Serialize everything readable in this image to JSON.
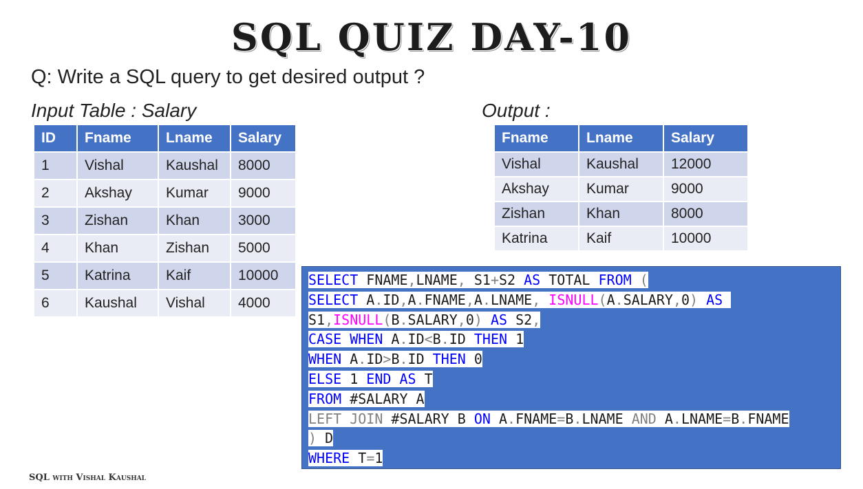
{
  "title": "SQL QUIZ DAY-10",
  "question": "Q: Write a SQL query to get desired output ?",
  "input": {
    "heading": "Input Table : Salary",
    "columns": [
      "ID",
      "Fname",
      "Lname",
      "Salary"
    ],
    "rows": [
      [
        "1",
        "Vishal",
        "Kaushal",
        "8000"
      ],
      [
        "2",
        "Akshay",
        "Kumar",
        "9000"
      ],
      [
        "3",
        "Zishan",
        "Khan",
        "3000"
      ],
      [
        "4",
        "Khan",
        "Zishan",
        "5000"
      ],
      [
        "5",
        "Katrina",
        "Kaif",
        "10000"
      ],
      [
        "6",
        "Kaushal",
        "Vishal",
        "4000"
      ]
    ]
  },
  "output": {
    "heading": "Output  :",
    "columns": [
      "Fname",
      "Lname",
      "Salary"
    ],
    "rows": [
      [
        "Vishal",
        "Kaushal",
        "12000"
      ],
      [
        "Akshay",
        "Kumar",
        "9000"
      ],
      [
        "Zishan",
        "Khan",
        "8000"
      ],
      [
        "Katrina",
        "Kaif",
        "10000"
      ]
    ]
  },
  "code": {
    "colors": {
      "keyword": "#0000ff",
      "function": "#ff00ff",
      "operator": "#808080",
      "box": "#4472c4"
    },
    "lines": [
      [
        [
          "kw",
          "SELECT"
        ],
        [
          "id",
          " FNAME"
        ],
        [
          "op",
          ","
        ],
        [
          "id",
          "LNAME"
        ],
        [
          "op",
          ","
        ],
        [
          "id",
          " S1"
        ],
        [
          "op",
          "+"
        ],
        [
          "id",
          "S2 "
        ],
        [
          "kw",
          "AS"
        ],
        [
          "id",
          " TOTAL "
        ],
        [
          "kw",
          "FROM"
        ],
        [
          "id",
          " "
        ],
        [
          "op",
          "("
        ]
      ],
      [
        [
          "kw",
          "SELECT"
        ],
        [
          "id",
          " A"
        ],
        [
          "op",
          "."
        ],
        [
          "id",
          "ID"
        ],
        [
          "op",
          ","
        ],
        [
          "id",
          "A"
        ],
        [
          "op",
          "."
        ],
        [
          "id",
          "FNAME"
        ],
        [
          "op",
          ","
        ],
        [
          "id",
          "A"
        ],
        [
          "op",
          "."
        ],
        [
          "id",
          "LNAME"
        ],
        [
          "op",
          ","
        ],
        [
          "id",
          " "
        ],
        [
          "fn",
          "ISNULL"
        ],
        [
          "op",
          "("
        ],
        [
          "id",
          "A"
        ],
        [
          "op",
          "."
        ],
        [
          "id",
          "SALARY"
        ],
        [
          "op",
          ","
        ],
        [
          "id",
          "0"
        ],
        [
          "op",
          ")"
        ],
        [
          "id",
          " "
        ],
        [
          "kw",
          "AS"
        ],
        [
          "id",
          " "
        ]
      ],
      [
        [
          "id",
          "S1"
        ],
        [
          "op",
          ","
        ],
        [
          "fn",
          "ISNULL"
        ],
        [
          "op",
          "("
        ],
        [
          "id",
          "B"
        ],
        [
          "op",
          "."
        ],
        [
          "id",
          "SALARY"
        ],
        [
          "op",
          ","
        ],
        [
          "id",
          "0"
        ],
        [
          "op",
          ")"
        ],
        [
          "id",
          " "
        ],
        [
          "kw",
          "AS"
        ],
        [
          "id",
          " S2"
        ],
        [
          "op",
          ","
        ]
      ],
      [
        [
          "kw",
          "CASE"
        ],
        [
          "id",
          " "
        ],
        [
          "kw",
          "WHEN"
        ],
        [
          "id",
          " A"
        ],
        [
          "op",
          "."
        ],
        [
          "id",
          "ID"
        ],
        [
          "op",
          "<"
        ],
        [
          "id",
          "B"
        ],
        [
          "op",
          "."
        ],
        [
          "id",
          "ID "
        ],
        [
          "kw",
          "THEN"
        ],
        [
          "id",
          " 1"
        ]
      ],
      [
        [
          "kw",
          "WHEN"
        ],
        [
          "id",
          " A"
        ],
        [
          "op",
          "."
        ],
        [
          "id",
          "ID"
        ],
        [
          "op",
          ">"
        ],
        [
          "id",
          "B"
        ],
        [
          "op",
          "."
        ],
        [
          "id",
          "ID "
        ],
        [
          "kw",
          "THEN"
        ],
        [
          "id",
          " 0"
        ]
      ],
      [
        [
          "kw",
          "ELSE"
        ],
        [
          "id",
          " 1 "
        ],
        [
          "kw",
          "END"
        ],
        [
          "id",
          " "
        ],
        [
          "kw",
          "AS"
        ],
        [
          "id",
          " T"
        ]
      ],
      [
        [
          "kw",
          "FROM"
        ],
        [
          "id",
          " #SALARY A"
        ]
      ],
      [
        [
          "op",
          "LEFT"
        ],
        [
          "id",
          " "
        ],
        [
          "op",
          "JOIN"
        ],
        [
          "id",
          " #SALARY B "
        ],
        [
          "kw",
          "ON"
        ],
        [
          "id",
          " A"
        ],
        [
          "op",
          "."
        ],
        [
          "id",
          "FNAME"
        ],
        [
          "op",
          "="
        ],
        [
          "id",
          "B"
        ],
        [
          "op",
          "."
        ],
        [
          "id",
          "LNAME "
        ],
        [
          "op",
          "AND"
        ],
        [
          "id",
          " A"
        ],
        [
          "op",
          "."
        ],
        [
          "id",
          "LNAME"
        ],
        [
          "op",
          "="
        ],
        [
          "id",
          "B"
        ],
        [
          "op",
          "."
        ],
        [
          "id",
          "FNAME"
        ]
      ],
      [
        [
          "op",
          ")"
        ],
        [
          "id",
          " D"
        ]
      ],
      [
        [
          "kw",
          "WHERE"
        ],
        [
          "id",
          " T"
        ],
        [
          "op",
          "="
        ],
        [
          "id",
          "1"
        ]
      ]
    ]
  },
  "footer": "SQL with Vishal Kaushal"
}
